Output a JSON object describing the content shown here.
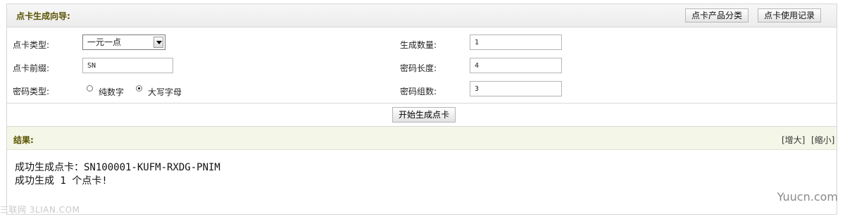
{
  "header": {
    "title": "点卡生成向导:",
    "btn_categories": "点卡产品分类",
    "btn_usage_log": "点卡使用记录"
  },
  "form": {
    "card_type_label": "点卡类型:",
    "card_type_value": "一元一点",
    "prefix_label": "点卡前缀:",
    "prefix_value": "SN",
    "pwd_type_label": "密码类型:",
    "pwd_type_options": [
      "纯数字",
      "大写字母"
    ],
    "pwd_type_selected": "大写字母",
    "quantity_label": "生成数量:",
    "quantity_value": "1",
    "pwd_length_label": "密码长度:",
    "pwd_length_value": "4",
    "pwd_groups_label": "密码组数:",
    "pwd_groups_value": "3",
    "submit_label": "开始生成点卡"
  },
  "result": {
    "title": "结果:",
    "zoom_in": "[增大]",
    "zoom_out": "[缩小]",
    "lines": [
      "成功生成点卡：SN100001-KUFM-RXDG-PNIM",
      "成功生成 1 个点卡!"
    ]
  },
  "watermarks": {
    "left": "三联网 3LIAN.COM",
    "right": "Yuucn.com"
  }
}
